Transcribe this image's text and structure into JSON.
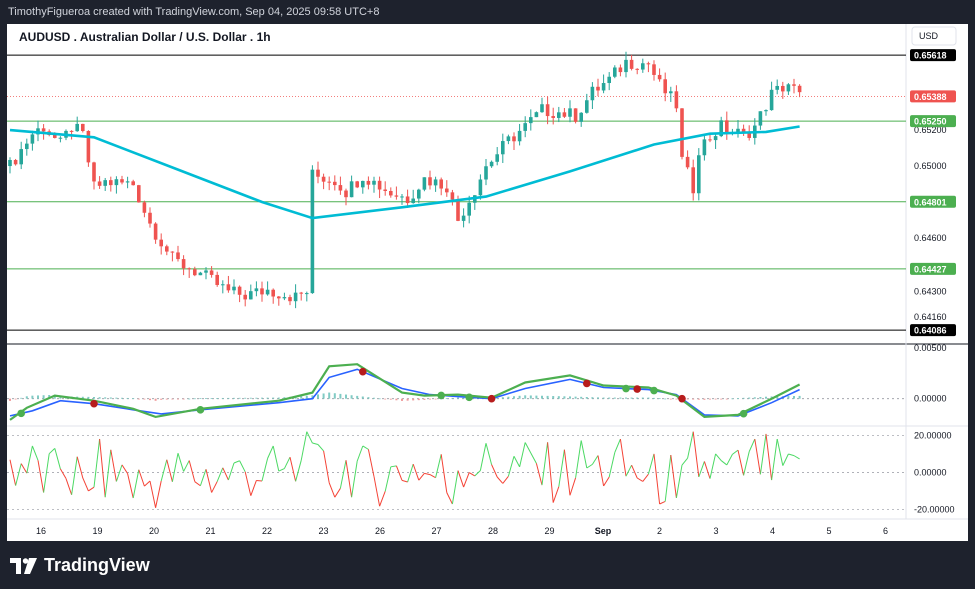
{
  "header": {
    "credit": "TimothyFigueroa created with TradingView.com, Sep 04, 2025 09:58 UTC+8"
  },
  "footer": {
    "brand": "TradingView"
  },
  "colors": {
    "up": "#26a69a",
    "down": "#ef5350",
    "ma": "#00bcd4",
    "level": "#4caf50",
    "osc_fast": "#4caf50",
    "osc_slow": "#2962ff",
    "osc_red": "#b71c1c",
    "rsi_up": "#4cd964",
    "rsi_down": "#f44336",
    "resistance": "#000000"
  },
  "chart_data": [
    {
      "type": "candlestick",
      "title": "AUDUSD . Australian Dollar / U.S. Dollar . 1h",
      "currency": "USD",
      "ylim": [
        0.6402,
        0.6578
      ],
      "y_ticks": [
        "0.65200",
        "0.65000",
        "0.64600",
        "0.64300",
        "0.64160"
      ],
      "x_ticks": [
        "16",
        "19",
        "20",
        "21",
        "22",
        "23",
        "26",
        "27",
        "28",
        "29",
        "Sep",
        "2",
        "3",
        "4",
        "5",
        "6"
      ],
      "levels": [
        {
          "value": 0.65618,
          "label": "0.65618",
          "kind": "resistance"
        },
        {
          "value": 0.65388,
          "label": "0.65388",
          "kind": "current"
        },
        {
          "value": 0.6525,
          "label": "0.65250",
          "kind": "level"
        },
        {
          "value": 0.64801,
          "label": "0.64801",
          "kind": "level"
        },
        {
          "value": 0.64427,
          "label": "0.64427",
          "kind": "level"
        },
        {
          "value": 0.64086,
          "label": "0.64086",
          "kind": "resistance"
        }
      ],
      "close_path": [
        [
          0,
          0.65
        ],
        [
          4,
          0.6518
        ],
        [
          6,
          0.6522
        ],
        [
          9,
          0.6512
        ],
        [
          11,
          0.6522
        ],
        [
          13,
          0.6517
        ],
        [
          15,
          0.6488
        ],
        [
          17,
          0.6491
        ],
        [
          22,
          0.649
        ],
        [
          25,
          0.6468
        ],
        [
          29,
          0.6448
        ],
        [
          34,
          0.644
        ],
        [
          39,
          0.643
        ],
        [
          42,
          0.6428
        ],
        [
          46,
          0.6431
        ],
        [
          51,
          0.6427
        ],
        [
          53,
          0.643
        ],
        [
          54,
          0.6495
        ],
        [
          58,
          0.6492
        ],
        [
          60,
          0.6486
        ],
        [
          63,
          0.6495
        ],
        [
          68,
          0.6485
        ],
        [
          71,
          0.6482
        ],
        [
          74,
          0.6493
        ],
        [
          78,
          0.6489
        ],
        [
          80,
          0.647
        ],
        [
          83,
          0.6487
        ],
        [
          85,
          0.65
        ],
        [
          89,
          0.6514
        ],
        [
          92,
          0.6522
        ],
        [
          95,
          0.6531
        ],
        [
          98,
          0.653
        ],
        [
          101,
          0.6528
        ],
        [
          104,
          0.6541
        ],
        [
          107,
          0.6548
        ],
        [
          110,
          0.6558
        ],
        [
          114,
          0.6557
        ],
        [
          116,
          0.6545
        ],
        [
          119,
          0.6534
        ],
        [
          120,
          0.6503
        ],
        [
          122,
          0.6488
        ],
        [
          123,
          0.651
        ],
        [
          127,
          0.6522
        ],
        [
          131,
          0.6517
        ],
        [
          133,
          0.6522
        ],
        [
          136,
          0.654
        ],
        [
          139,
          0.6546
        ],
        [
          141,
          0.6539
        ]
      ],
      "moving_average": [
        [
          0,
          0.652
        ],
        [
          15,
          0.6516
        ],
        [
          30,
          0.6498
        ],
        [
          45,
          0.648
        ],
        [
          54,
          0.6471
        ],
        [
          70,
          0.6477
        ],
        [
          85,
          0.6483
        ],
        [
          100,
          0.6497
        ],
        [
          115,
          0.6512
        ],
        [
          125,
          0.6518
        ],
        [
          135,
          0.6519
        ],
        [
          141,
          0.6522
        ]
      ]
    },
    {
      "type": "line",
      "ylim": [
        -0.0025,
        0.0052
      ],
      "y_ticks": [
        "0.00500",
        "0.00000"
      ],
      "fast": [
        [
          0,
          -0.0021
        ],
        [
          3,
          -0.0009
        ],
        [
          8,
          0.0003
        ],
        [
          15,
          -0.0002
        ],
        [
          22,
          -0.001
        ],
        [
          26,
          -0.0018
        ],
        [
          34,
          -0.001
        ],
        [
          48,
          -0.0002
        ],
        [
          54,
          0.0006
        ],
        [
          57,
          0.0032
        ],
        [
          62,
          0.0034
        ],
        [
          70,
          0.0006
        ],
        [
          74,
          0.0003
        ],
        [
          80,
          0.0004
        ],
        [
          86,
          0.0001
        ],
        [
          92,
          0.0016
        ],
        [
          100,
          0.0023
        ],
        [
          106,
          0.0013
        ],
        [
          114,
          0.0011
        ],
        [
          119,
          0.0003
        ],
        [
          124,
          -0.0018
        ],
        [
          130,
          -0.0016
        ],
        [
          136,
          0.0
        ],
        [
          141,
          0.0014
        ]
      ],
      "slow": [
        [
          0,
          -0.0017
        ],
        [
          4,
          -0.0012
        ],
        [
          9,
          -0.0002
        ],
        [
          15,
          -0.0005
        ],
        [
          22,
          -0.0011
        ],
        [
          27,
          -0.0015
        ],
        [
          34,
          -0.0011
        ],
        [
          48,
          -0.0004
        ],
        [
          54,
          0.0
        ],
        [
          57,
          0.0021
        ],
        [
          62,
          0.0029
        ],
        [
          70,
          0.001
        ],
        [
          75,
          0.0004
        ],
        [
          80,
          0.0002
        ],
        [
          86,
          0.0
        ],
        [
          92,
          0.001
        ],
        [
          100,
          0.0019
        ],
        [
          106,
          0.0011
        ],
        [
          114,
          0.0009
        ],
        [
          119,
          0.0004
        ],
        [
          124,
          -0.0016
        ],
        [
          130,
          -0.0017
        ],
        [
          136,
          -0.0004
        ],
        [
          141,
          0.0009
        ]
      ]
    },
    {
      "type": "line",
      "ylim": [
        -24,
        24
      ],
      "y_ticks": [
        "20.00000",
        "0.00000",
        "-20.00000"
      ]
    }
  ]
}
